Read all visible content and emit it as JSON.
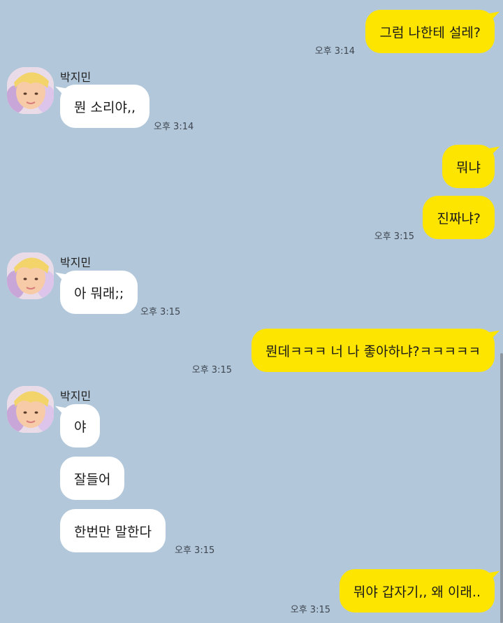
{
  "contact": {
    "name": "박지민"
  },
  "messages": [
    {
      "sender": "me",
      "text": "그럼 나한테 설레?",
      "time": "오후 3:14"
    },
    {
      "sender": "other",
      "text": "뭔 소리야,,",
      "time": "오후 3:14"
    },
    {
      "sender": "me",
      "text": "뭐냐",
      "time": ""
    },
    {
      "sender": "me",
      "text": "진짜냐?",
      "time": "오후 3:15"
    },
    {
      "sender": "other",
      "text": "아 뭐래;;",
      "time": "오후 3:15"
    },
    {
      "sender": "me",
      "text": "뭔데ㅋㅋㅋ 너 나 좋아하냐?ㅋㅋㅋㅋㅋ",
      "time": "오후 3:15"
    },
    {
      "sender": "other",
      "text": "야",
      "time": ""
    },
    {
      "sender": "other",
      "text": "잘들어",
      "time": ""
    },
    {
      "sender": "other",
      "text": "한번만 말한다",
      "time": "오후 3:15"
    },
    {
      "sender": "me",
      "text": "뭐야 갑자기,, 왜 이래..",
      "time": "오후 3:15"
    }
  ],
  "colors": {
    "background": "#b2c7da",
    "my_bubble": "#fee500",
    "their_bubble": "#ffffff"
  },
  "icons": {
    "avatar": "profile-photo"
  }
}
